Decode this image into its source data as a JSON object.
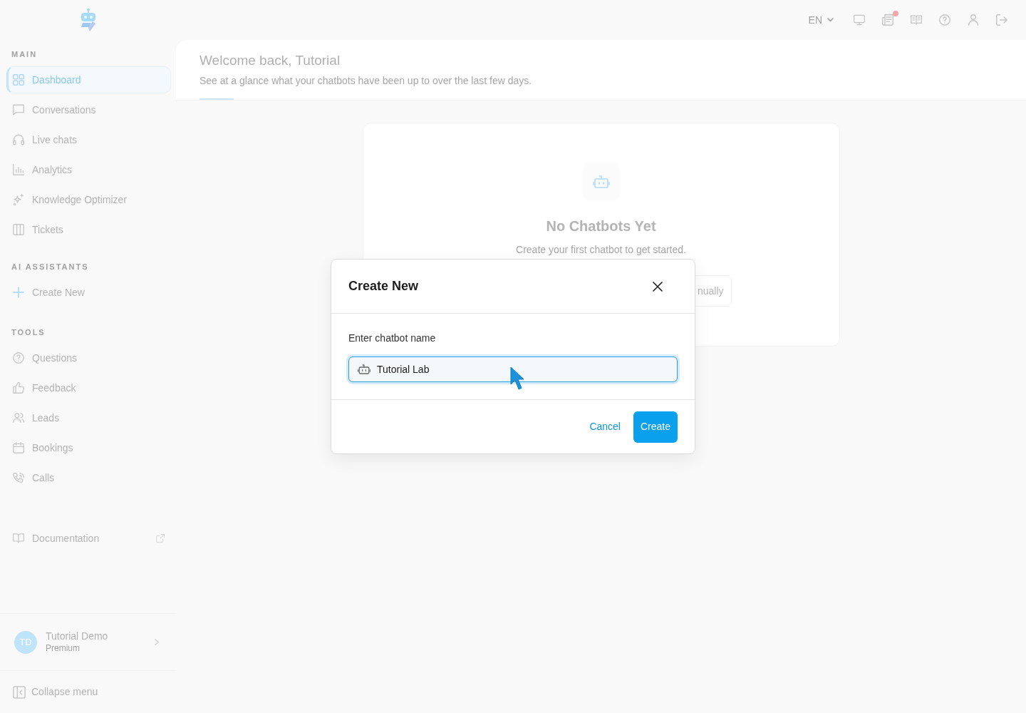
{
  "top_bar": {
    "language": "EN",
    "notification_dot": true
  },
  "sidebar": {
    "sections": [
      {
        "heading": "MAIN",
        "items": [
          {
            "label": "Dashboard",
            "selected": true
          },
          {
            "label": "Conversations",
            "selected": false
          },
          {
            "label": "Live chats",
            "selected": false
          },
          {
            "label": "Analytics",
            "selected": false
          },
          {
            "label": "Knowledge Optimizer",
            "selected": false
          },
          {
            "label": "Tickets",
            "selected": false
          }
        ]
      },
      {
        "heading": "AI ASSISTANTS",
        "items": [
          {
            "label": "Create New",
            "selected": false
          }
        ]
      },
      {
        "heading": "TOOLS",
        "items": [
          {
            "label": "Questions",
            "selected": false
          },
          {
            "label": "Feedback",
            "selected": false
          },
          {
            "label": "Leads",
            "selected": false
          },
          {
            "label": "Bookings",
            "selected": false
          },
          {
            "label": "Calls",
            "selected": false
          }
        ]
      }
    ],
    "documentation": "Documentation",
    "user": {
      "initials": "TD",
      "name": "Tutorial Demo",
      "plan": "Premium"
    },
    "collapse": "Collapse menu"
  },
  "header": {
    "title": "Welcome back, Tutorial",
    "subtitle": "See at a glance what your chatbots have been up to over the last few days."
  },
  "empty_state": {
    "title": "No Chatbots Yet",
    "text": "Create your first chatbot to get started.",
    "button": "nually"
  },
  "dialog": {
    "title": "Create New",
    "field": {
      "label": "Enter chatbot name",
      "value": "Tutorial Lab",
      "focused": true
    },
    "buttons": [
      {
        "label": "Cancel",
        "kind": "link"
      },
      {
        "label": "Create",
        "kind": "primary"
      }
    ]
  }
}
